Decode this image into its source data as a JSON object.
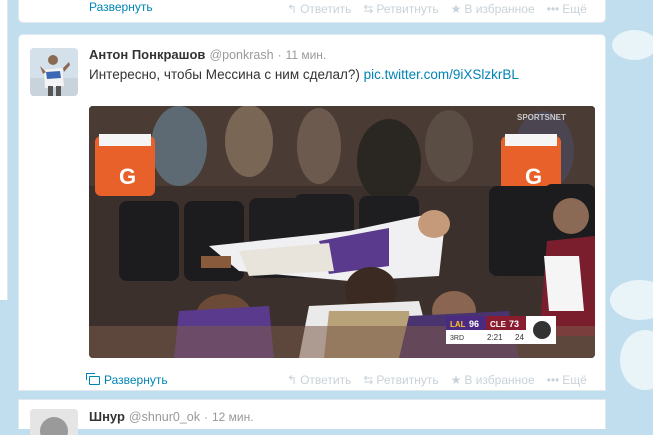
{
  "colors": {
    "link": "#0084b4",
    "muted": "#999999",
    "action": "#c8d2d8",
    "background": "#c0deed"
  },
  "previous_tweet": {
    "expand_label": "Развернуть",
    "actions": [
      {
        "icon": "reply-icon",
        "label": "Ответить"
      },
      {
        "icon": "retweet-icon",
        "label": "Ретвитнуть"
      },
      {
        "icon": "star-icon",
        "label": "В избранное"
      },
      {
        "icon": "more-icon",
        "label": "Ещё"
      }
    ]
  },
  "tweet": {
    "fullname": "Антон Понкрашов",
    "username": "@ponkrash",
    "separator": "·",
    "time": "11 мин.",
    "text": "Интересно, чтобы Мессина с ним сделал?)",
    "link": "pic.twitter.com/9iXSlzkrBL",
    "media": {
      "watermark": "SPORTSNET",
      "scoreboard": {
        "team1": "LAL",
        "score1": "96",
        "team2": "CLE",
        "score2": "73",
        "period": "3RD",
        "clock": "2:21",
        "shot_clock": "24"
      }
    },
    "expand_label": "Развернуть",
    "actions": [
      {
        "icon": "reply-icon",
        "label": "Ответить"
      },
      {
        "icon": "retweet-icon",
        "label": "Ретвитнуть"
      },
      {
        "icon": "star-icon",
        "label": "В избранное"
      },
      {
        "icon": "more-icon",
        "label": "Ещё"
      }
    ]
  },
  "next_tweet": {
    "fullname": "Шнур",
    "username": "@shnur0_ok",
    "separator": "·",
    "time": "12 мин."
  }
}
